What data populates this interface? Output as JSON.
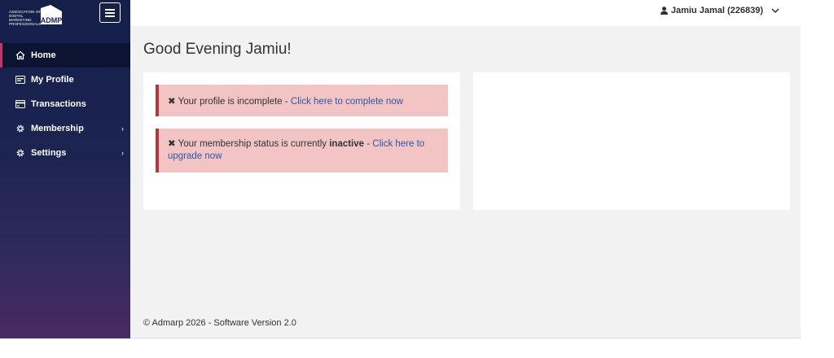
{
  "logo": {
    "text": "Association of Digital Marketing Professionals",
    "mark": "ADMP"
  },
  "colors": {
    "sidebar_top": "#151f4a",
    "sidebar_bottom": "#4a2a63",
    "active_accent": "#c0396a",
    "alert_bg": "#f2c4c4",
    "alert_border": "#b8363a",
    "link": "#2f55a8"
  },
  "sidebar": {
    "toggle_icon": "hamburger-icon",
    "items": [
      {
        "label": "Home",
        "icon": "home-icon",
        "active": true,
        "has_submenu": false
      },
      {
        "label": "My Profile",
        "icon": "id-card-icon",
        "active": false,
        "has_submenu": false
      },
      {
        "label": "Transactions",
        "icon": "credit-card-icon",
        "active": false,
        "has_submenu": false
      },
      {
        "label": "Membership",
        "icon": "gear-icon",
        "active": false,
        "has_submenu": true
      },
      {
        "label": "Settings",
        "icon": "gear-icon",
        "active": false,
        "has_submenu": true
      }
    ],
    "submenu_glyph": "›"
  },
  "header": {
    "user_label": "Jamiu Jamal (226839)",
    "user_icon": "user-icon",
    "dropdown_icon": "chevron-down-icon"
  },
  "main": {
    "greeting": "Good Evening Jamiu!",
    "alerts": [
      {
        "prefix": "Your profile is incomplete - ",
        "link": "Click here to complete now"
      },
      {
        "prefix": "Your membership status is currently ",
        "bold": "inactive",
        "separator": " - ",
        "link": "Click here to upgrade now"
      }
    ],
    "alert_close_glyph": "✖"
  },
  "footer": {
    "text": "© Admarp 2026 - Software Version 2.0"
  }
}
